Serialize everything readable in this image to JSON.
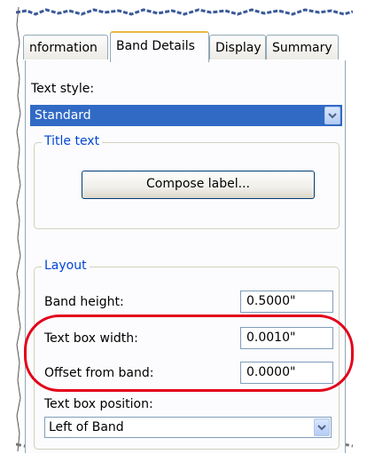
{
  "tabs": [
    {
      "label": "nformation",
      "active": false
    },
    {
      "label": "Band Details",
      "active": true
    },
    {
      "label": "Display",
      "active": false
    },
    {
      "label": "Summary",
      "active": false
    }
  ],
  "text_style": {
    "label": "Text style:",
    "value": "Standard"
  },
  "title_text": {
    "legend": "Title text",
    "compose_button": "Compose label..."
  },
  "layout": {
    "legend": "Layout",
    "band_height": {
      "label": "Band height:",
      "value": "0.5000\""
    },
    "text_box_width": {
      "label": "Text box width:",
      "value": "0.0010\""
    },
    "offset_from_band": {
      "label": "Offset from band:",
      "value": "0.0000\""
    },
    "text_box_position": {
      "label": "Text box position:",
      "value": "Left of Band"
    }
  },
  "colors": {
    "accent": "#0046d5",
    "highlight_oval": "#e3001a",
    "selection": "#316ac5"
  }
}
